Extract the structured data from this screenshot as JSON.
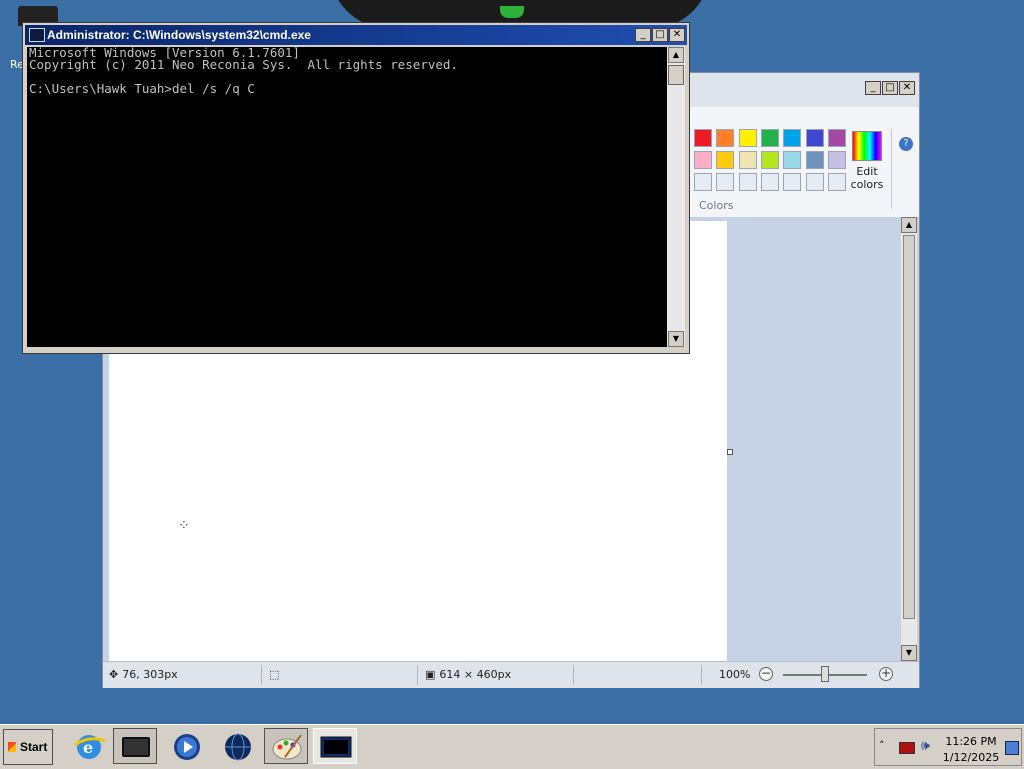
{
  "desktop": {
    "icon_label": "Re"
  },
  "cmd": {
    "title": "Administrator: C:\\Windows\\system32\\cmd.exe",
    "lines": [
      "Microsoft Windows [Version 6.1.7601]",
      "Copyright (c) 2011 Neo Reconia Sys.  All rights reserved.",
      "",
      "C:\\Users\\Hawk Tuah>del /s /q C"
    ],
    "buttons": {
      "minimize": "_",
      "maximize": "□",
      "close": "✕"
    }
  },
  "paint": {
    "buttons": {
      "minimize": "_",
      "maximize": "□",
      "close": "✕"
    },
    "help_icon": "?",
    "colors_group_label": "Colors",
    "edit_colors_label": "Edit colors",
    "palette_row1": [
      "#ed1c24",
      "#ff7f27",
      "#fff200",
      "#22b14c",
      "#00a2e8",
      "#3f48cc",
      "#a349a4"
    ],
    "palette_row2": [
      "#ffaec9",
      "#ffc90e",
      "#efe4b0",
      "#b5e61d",
      "#99d9ea",
      "#7092be",
      "#c8bfe7"
    ],
    "palette_row3": [
      "#e6ecf3",
      "#e6ecf3",
      "#e6ecf3",
      "#e6ecf3",
      "#e6ecf3",
      "#e6ecf3",
      "#e6ecf3"
    ],
    "status": {
      "cursor_pos": "76, 303px",
      "selection_size": "",
      "canvas_size": "614 × 460px",
      "zoom": "100%"
    }
  },
  "taskbar": {
    "start_label": "Start",
    "apps": [
      "internet-explorer-icon",
      "terminal-app-icon",
      "media-player-icon",
      "network-globe-icon",
      "paint-icon",
      "cmd-icon"
    ],
    "clock_time": "11:26 PM",
    "clock_date": "1/12/2025"
  }
}
